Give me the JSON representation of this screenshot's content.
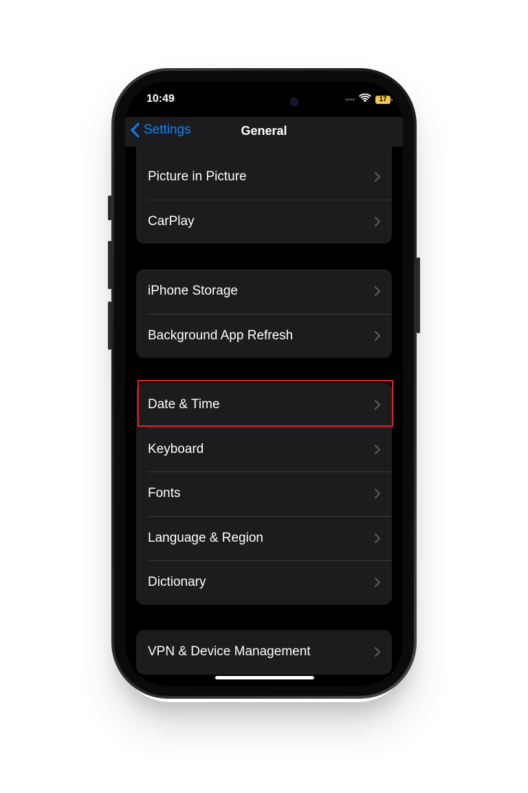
{
  "status_bar": {
    "time": "10:49",
    "battery": "17",
    "signal_dots": "••••"
  },
  "nav": {
    "back_label": "Settings",
    "title": "General"
  },
  "groups": [
    {
      "items": [
        {
          "label": "Picture in Picture"
        },
        {
          "label": "CarPlay"
        }
      ]
    },
    {
      "items": [
        {
          "label": "iPhone Storage"
        },
        {
          "label": "Background App Refresh"
        }
      ]
    },
    {
      "items": [
        {
          "label": "Date & Time"
        },
        {
          "label": "Keyboard"
        },
        {
          "label": "Fonts"
        },
        {
          "label": "Language & Region"
        },
        {
          "label": "Dictionary"
        }
      ]
    },
    {
      "items": [
        {
          "label": "VPN & Device Management"
        }
      ]
    }
  ],
  "colors": {
    "accent": "#0a84ff",
    "highlight": "#e0242c",
    "cell_bg": "#1c1c1e",
    "battery": "#f2c94c"
  },
  "icons": {
    "back": "chevron-left-icon",
    "row": "chevron-right-icon",
    "wifi": "wifi-icon",
    "battery": "battery-icon"
  }
}
